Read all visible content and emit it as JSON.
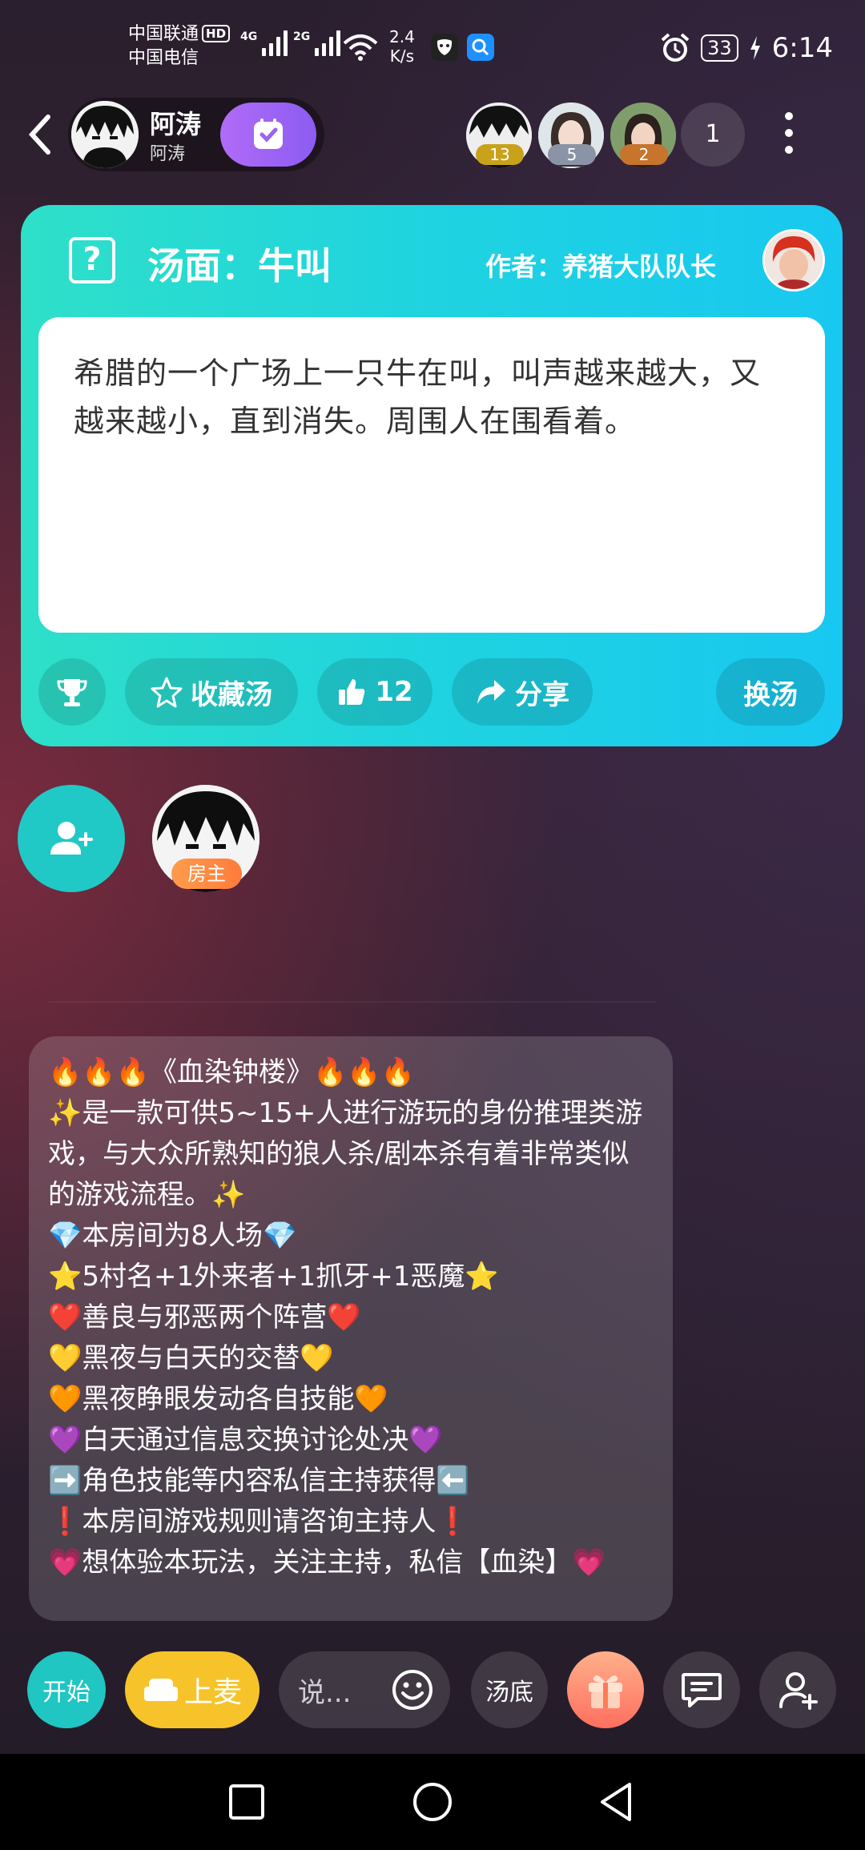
{
  "status_bar": {
    "carrier1": "中国联通",
    "carrier2": "中国电信",
    "hd": "HD",
    "gen1": "4G",
    "gen2": "2G",
    "speed_value": "2.4",
    "speed_unit": "K/s",
    "battery": "33",
    "time": "6:14"
  },
  "header": {
    "host_name": "阿涛",
    "host_sub": "阿涛",
    "viewers": [
      {
        "badge": "13",
        "badge_color": "#c9a21b"
      },
      {
        "badge": "5",
        "badge_color": "#8a94a6"
      },
      {
        "badge": "2",
        "badge_color": "#c7742c"
      }
    ],
    "viewer_count": "1"
  },
  "soup_card": {
    "title": "汤面：牛叫",
    "author": "作者：养猪大队队长",
    "body": "希腊的一个广场上一只牛在叫，叫声越来越大，又越来越小，直到消失。周围人在围看着。",
    "collect_label": "收藏汤",
    "like_count": "12",
    "share_label": "分享",
    "change_label": "换汤"
  },
  "seats": {
    "owner_badge": "房主"
  },
  "announcement": {
    "lines": [
      "🔥🔥🔥《血染钟楼》🔥🔥🔥",
      "✨是一款可供5~15+人进行游玩的身份推理类游戏，与大众所熟知的狼人杀/剧本杀有着非常类似的游戏流程。✨",
      "💎本房间为8人场💎",
      "⭐5村名+1外来者+1抓牙+1恶魔⭐",
      "❤️善良与邪恶两个阵营❤️",
      "💛黑夜与白天的交替💛",
      "🧡黑夜睁眼发动各自技能🧡",
      "💜白天通过信息交换讨论处决💜",
      "➡️角色技能等内容私信主持获得⬅️",
      "❗本房间游戏规则请咨询主持人❗",
      "💗想体验本玩法，关注主持，私信【血染】💗"
    ]
  },
  "bottom_bar": {
    "start_label": "开始",
    "mic_label": "上麦",
    "say_placeholder": "说...",
    "answer_label": "汤底"
  },
  "colors": {
    "card_start": "#2ee0c8",
    "card_end": "#19c8f0",
    "accent_yellow": "#f6c42a",
    "accent_teal": "#1fc6c2",
    "follow_purple": "#9c63f4"
  }
}
